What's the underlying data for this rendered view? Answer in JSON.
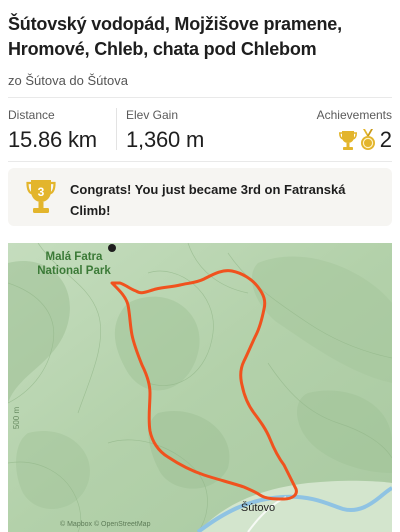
{
  "activity": {
    "title": "Šútovský vodopád, Mojžišove pramene, Hromové, Chleb, chata pod Chlebom",
    "subtitle": "zo Šútova do Šútova"
  },
  "stats": {
    "distance": {
      "label": "Distance",
      "value": "15.86 km"
    },
    "elev_gain": {
      "label": "Elev Gain",
      "value": "1,360 m"
    },
    "achievements": {
      "label": "Achievements",
      "count": "2",
      "icons": [
        "trophy-icon",
        "medal-icon"
      ]
    }
  },
  "banner": {
    "icon": "third-place-trophy-icon",
    "icon_text": "3",
    "text": "Congrats! You just became 3rd on Fatranská Climb!"
  },
  "map": {
    "park_label": "Malá Fatra National Park",
    "village_label": "Šútovo",
    "elevation_label": "500 m",
    "attribution": "© Mapbox © OpenStreetMap",
    "route_color": "#f0521e",
    "gold_color": "#e3b52c"
  }
}
